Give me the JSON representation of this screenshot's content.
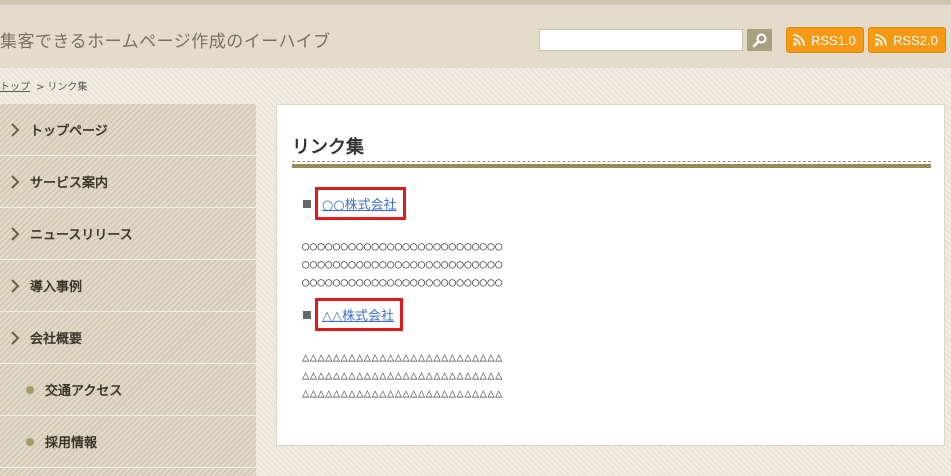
{
  "header": {
    "site_title": "集客できるホームページ作成のイーハイブ",
    "search": {
      "value": "",
      "placeholder": ""
    },
    "rss": [
      {
        "label": "RSS1.0"
      },
      {
        "label": "RSS2.0"
      }
    ]
  },
  "breadcrumb": {
    "home": "トップ",
    "separator": ">",
    "current": "リンク集"
  },
  "sidebar": {
    "items": [
      {
        "label": "トップページ"
      },
      {
        "label": "サービス案内"
      },
      {
        "label": "ニュースリリース"
      },
      {
        "label": "導入事例"
      },
      {
        "label": "会社概要"
      }
    ],
    "sub_items": [
      {
        "label": "交通アクセス"
      },
      {
        "label": "採用情報"
      }
    ]
  },
  "main": {
    "title": "リンク集",
    "entries": [
      {
        "link": "○○株式会社",
        "lines": [
          "○○○○○○○○○○○○○○○○○○○○○○○○○○",
          "○○○○○○○○○○○○○○○○○○○○○○○○○○",
          "○○○○○○○○○○○○○○○○○○○○○○○○○○"
        ]
      },
      {
        "link": "△△株式会社",
        "lines": [
          "△△△△△△△△△△△△△△△△△△△△△△△△△△",
          "△△△△△△△△△△△△△△△△△△△△△△△△△△",
          "△△△△△△△△△△△△△△△△△△△△△△△△△△"
        ]
      }
    ]
  },
  "colors": {
    "rss_orange": "#f59a12",
    "highlight_red": "#e01b1b",
    "link_blue": "#3d6fd0",
    "rule_olive": "#978b57"
  }
}
